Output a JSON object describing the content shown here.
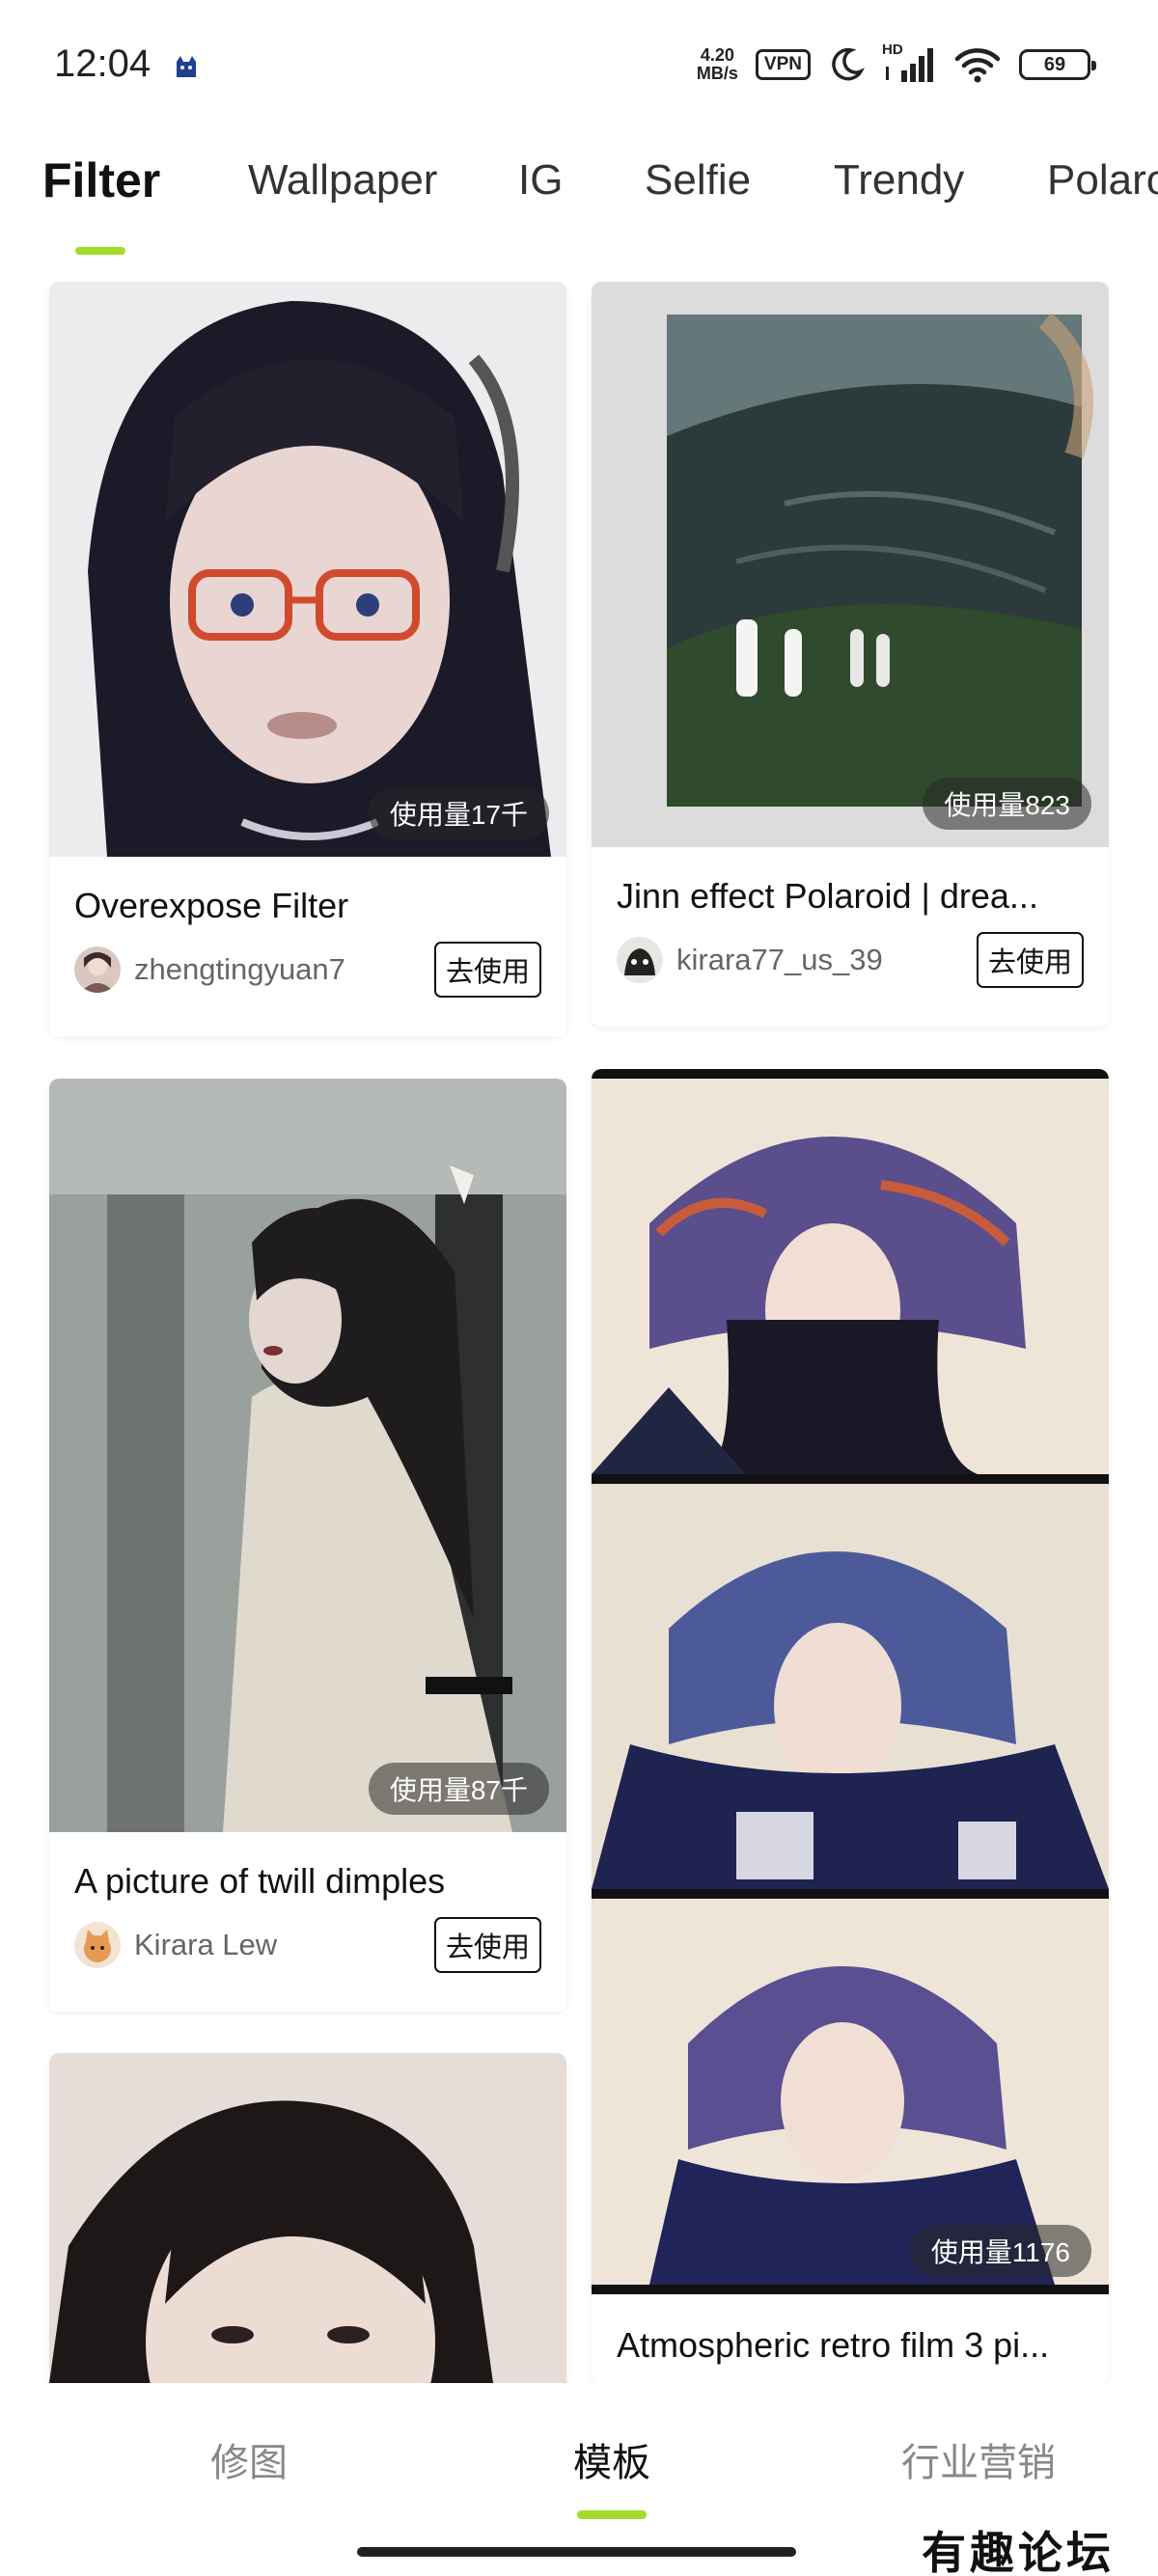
{
  "status_bar": {
    "time": "12:04",
    "net_speed_value": "4.20",
    "net_speed_unit": "MB/s",
    "vpn": "VPN",
    "network_label": "HD",
    "battery": "69"
  },
  "tabs": [
    {
      "label": "Filter",
      "active": true
    },
    {
      "label": "Wallpaper"
    },
    {
      "label": "IG"
    },
    {
      "label": "Selfie"
    },
    {
      "label": "Trendy"
    },
    {
      "label": "Polaroid"
    }
  ],
  "cards": [
    {
      "title": "Overexpose Filter",
      "author": "zhengtingyuan7",
      "usage": "使用量17千",
      "button": "去使用"
    },
    {
      "title": "Jinn effect Polaroid | drea...",
      "author": "kirara77_us_39",
      "usage": "使用量823",
      "button": "去使用"
    },
    {
      "title": "A picture of twill dimples",
      "author": "Kirara Lew",
      "usage": "使用量87千",
      "button": "去使用"
    },
    {
      "title": "Atmospheric retro film 3 pi...",
      "usage": "使用量1176"
    }
  ],
  "bottom_nav": [
    {
      "label": "修图"
    },
    {
      "label": "模板",
      "active": true
    },
    {
      "label": "行业营销"
    }
  ],
  "watermark": "有趣论坛",
  "colors": {
    "accent": "#a3dc2b"
  }
}
